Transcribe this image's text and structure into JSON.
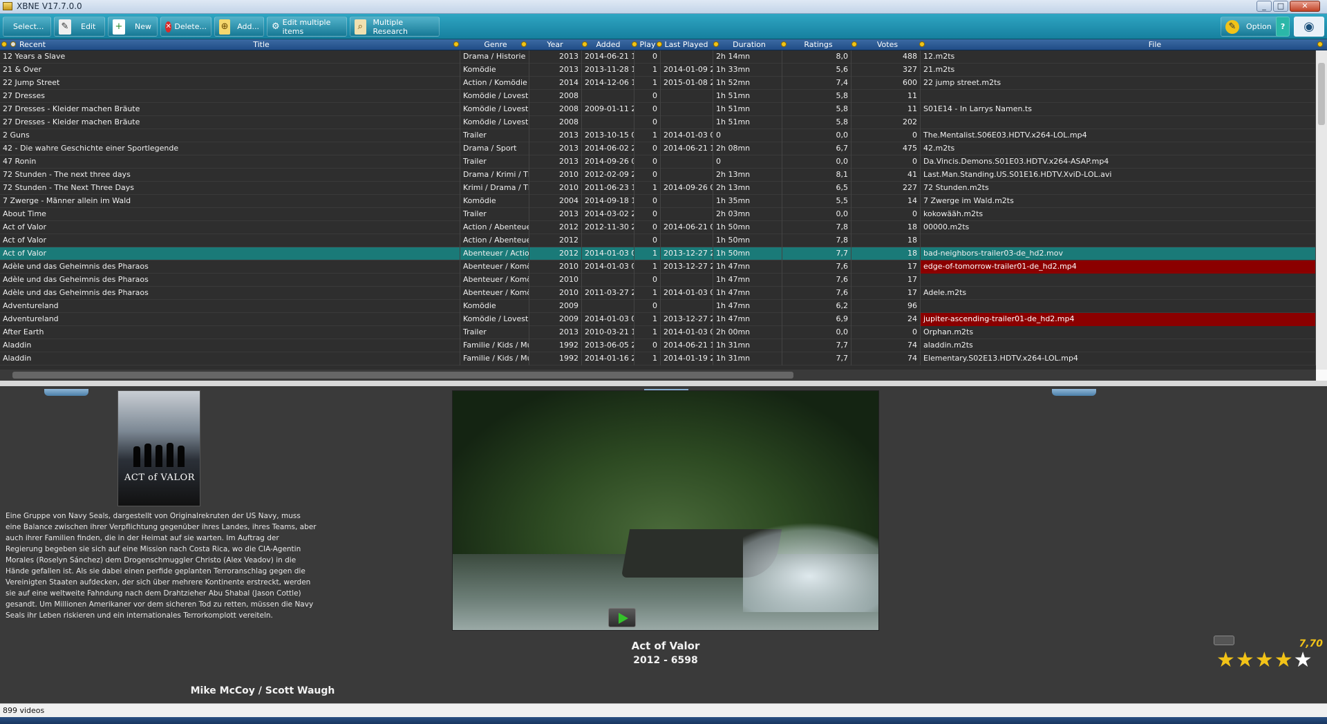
{
  "window": {
    "title": "XBNE V17.7.0.0",
    "min": "_",
    "max": "□",
    "close": "✕"
  },
  "toolbar": {
    "select": "Select...",
    "edit": "Edit",
    "new": "New",
    "delete": "Delete...",
    "add": "Add...",
    "edit_multiple": "Edit multiple items",
    "multiple_research": "Multiple Research",
    "option": "Option",
    "help": "?"
  },
  "columns": {
    "recent": "Recent",
    "title": "Title",
    "genre": "Genre",
    "year": "Year",
    "added": "Added",
    "play": "Play",
    "last_played": "Last Played",
    "duration": "Duration",
    "ratings": "Ratings",
    "votes": "Votes",
    "file": "File"
  },
  "rows": [
    {
      "title": "12 Years a Slave",
      "genre": "Drama / Historie",
      "year": "2013",
      "added": "2014-06-21 1",
      "play": "0",
      "last": "",
      "dur": "2h 14mn",
      "rating": "8,0",
      "votes": "488",
      "file": "12.m2ts"
    },
    {
      "title": "21 & Over",
      "genre": "Komödie",
      "year": "2013",
      "added": "2013-11-28 1",
      "play": "1",
      "last": "2014-01-09 22",
      "dur": "1h 33mn",
      "rating": "5,6",
      "votes": "327",
      "file": "21.m2ts"
    },
    {
      "title": "22 Jump Street",
      "genre": "Action / Komödie /",
      "year": "2014",
      "added": "2014-12-06 1",
      "play": "1",
      "last": "2015-01-08 23",
      "dur": "1h 52mn",
      "rating": "7,4",
      "votes": "600",
      "file": "22 jump street.m2ts"
    },
    {
      "title": "27 Dresses",
      "genre": "Komödie / Lovesto",
      "year": "2008",
      "added": "",
      "play": "0",
      "last": "",
      "dur": "1h 51mn",
      "rating": "5,8",
      "votes": "11",
      "file": ""
    },
    {
      "title": "27 Dresses - Kleider machen Bräute",
      "genre": "Komödie / Lovesto",
      "year": "2008",
      "added": "2009-01-11 2",
      "play": "0",
      "last": "",
      "dur": "1h 51mn",
      "rating": "5,8",
      "votes": "11",
      "file": "S01E14 - In Larrys Namen.ts"
    },
    {
      "title": "27 Dresses - Kleider machen Bräute",
      "genre": "Komödie / Lovesto",
      "year": "2008",
      "added": "",
      "play": "0",
      "last": "",
      "dur": "1h 51mn",
      "rating": "5,8",
      "votes": "202",
      "file": ""
    },
    {
      "title": "2 Guns",
      "genre": "Trailer",
      "year": "2013",
      "added": "2013-10-15 0",
      "play": "1",
      "last": "2014-01-03 02",
      "dur": "0",
      "rating": "0,0",
      "votes": "0",
      "file": "The.Mentalist.S06E03.HDTV.x264-LOL.mp4"
    },
    {
      "title": "42 - Die wahre Geschichte einer Sportlegende",
      "genre": "Drama / Sport",
      "year": "2013",
      "added": "2014-06-02 2",
      "play": "0",
      "last": "2014-06-21 14",
      "dur": "2h 08mn",
      "rating": "6,7",
      "votes": "475",
      "file": "42.m2ts"
    },
    {
      "title": "47 Ronin",
      "genre": "Trailer",
      "year": "2013",
      "added": "2014-09-26 0",
      "play": "0",
      "last": "",
      "dur": "0",
      "rating": "0,0",
      "votes": "0",
      "file": "Da.Vincis.Demons.S01E03.HDTV.x264-ASAP.mp4"
    },
    {
      "title": "72 Stunden - The next three days",
      "genre": "Drama / Krimi / Th",
      "year": "2010",
      "added": "2012-02-09 2",
      "play": "0",
      "last": "",
      "dur": "2h 13mn",
      "rating": "8,1",
      "votes": "41",
      "file": "Last.Man.Standing.US.S01E16.HDTV.XviD-LOL.avi"
    },
    {
      "title": "72 Stunden - The Next Three Days",
      "genre": "Krimi / Drama / Th",
      "year": "2010",
      "added": "2011-06-23 1",
      "play": "1",
      "last": "2014-09-26 00",
      "dur": "2h 13mn",
      "rating": "6,5",
      "votes": "227",
      "file": "72 Stunden.m2ts"
    },
    {
      "title": "7 Zwerge - Männer allein im Wald",
      "genre": "Komödie",
      "year": "2004",
      "added": "2014-09-18 1",
      "play": "0",
      "last": "",
      "dur": "1h 35mn",
      "rating": "5,5",
      "votes": "14",
      "file": "7 Zwerge im Wald.m2ts"
    },
    {
      "title": "About Time",
      "genre": "Trailer",
      "year": "2013",
      "added": "2014-03-02 2",
      "play": "0",
      "last": "",
      "dur": "2h 03mn",
      "rating": "0,0",
      "votes": "0",
      "file": "kokowääh.m2ts"
    },
    {
      "title": "Act of Valor",
      "genre": "Action / Abenteuer",
      "year": "2012",
      "added": "2012-11-30 2",
      "play": "0",
      "last": "2014-06-21 01",
      "dur": "1h 50mn",
      "rating": "7,8",
      "votes": "18",
      "file": "00000.m2ts"
    },
    {
      "title": "Act of Valor",
      "genre": "Action / Abenteuer",
      "year": "2012",
      "added": "",
      "play": "0",
      "last": "",
      "dur": "1h 50mn",
      "rating": "7,8",
      "votes": "18",
      "file": ""
    },
    {
      "title": "Act of Valor",
      "genre": "Abenteuer / Actior",
      "year": "2012",
      "added": "2014-01-03 0",
      "play": "1",
      "last": "2013-12-27 21",
      "dur": "1h 50mn",
      "rating": "7,7",
      "votes": "18",
      "file": "bad-neighbors-trailer03-de_hd2.mov",
      "selected": true
    },
    {
      "title": "Adèle und das Geheimnis des Pharaos",
      "genre": "Abenteuer / Komöc",
      "year": "2010",
      "added": "2014-01-03 0",
      "play": "1",
      "last": "2013-12-27 21",
      "dur": "1h 47mn",
      "rating": "7,6",
      "votes": "17",
      "file": "edge-of-tomorrow-trailer01-de_hd2.mp4",
      "highlight": true
    },
    {
      "title": "Adèle und das Geheimnis des Pharaos",
      "genre": "Abenteuer / Komöc",
      "year": "2010",
      "added": "",
      "play": "0",
      "last": "",
      "dur": "1h 47mn",
      "rating": "7,6",
      "votes": "17",
      "file": ""
    },
    {
      "title": "Adèle und das Geheimnis des Pharaos",
      "genre": "Abenteuer / Komöc",
      "year": "2010",
      "added": "2011-03-27 2",
      "play": "1",
      "last": "2014-01-03 03",
      "dur": "1h 47mn",
      "rating": "7,6",
      "votes": "17",
      "file": "Adele.m2ts"
    },
    {
      "title": "Adventureland",
      "genre": "Komödie",
      "year": "2009",
      "added": "",
      "play": "0",
      "last": "",
      "dur": "1h 47mn",
      "rating": "6,2",
      "votes": "96",
      "file": ""
    },
    {
      "title": "Adventureland",
      "genre": "Komödie / Lovesto",
      "year": "2009",
      "added": "2014-01-03 0",
      "play": "1",
      "last": "2013-12-27 21",
      "dur": "1h 47mn",
      "rating": "6,9",
      "votes": "24",
      "file": "jupiter-ascending-trailer01-de_hd2.mp4",
      "highlight": true
    },
    {
      "title": "After Earth",
      "genre": "Trailer",
      "year": "2013",
      "added": "2010-03-21 1",
      "play": "1",
      "last": "2014-01-03 03",
      "dur": "2h 00mn",
      "rating": "0,0",
      "votes": "0",
      "file": "Orphan.m2ts"
    },
    {
      "title": "Aladdin",
      "genre": "Familie / Kids / Mu:",
      "year": "1992",
      "added": "2013-06-05 2",
      "play": "0",
      "last": "2014-06-21 14",
      "dur": "1h 31mn",
      "rating": "7,7",
      "votes": "74",
      "file": "aladdin.m2ts"
    },
    {
      "title": "Aladdin",
      "genre": "Familie / Kids / Mu:",
      "year": "1992",
      "added": "2014-01-16 2",
      "play": "1",
      "last": "2014-01-19 21",
      "dur": "1h 31mn",
      "rating": "7,7",
      "votes": "74",
      "file": "Elementary.S02E13.HDTV.x264-LOL.mp4"
    }
  ],
  "detail": {
    "poster_title": "ACT of VALOR",
    "description": "Eine Gruppe von Navy Seals, dargestellt von Originalrekruten der US Navy, muss eine Balance zwischen ihrer Verpflichtung gegenüber ihres Landes, ihres Teams, aber auch ihrer Familien finden, die in der Heimat auf sie warten. Im Auftrag der Regierung begeben sie sich auf eine Mission nach Costa Rica, wo die CIA-Agentin Morales (Roselyn Sánchez) dem Drogenschmuggler Christo (Alex Veadov) in die Hände gefallen ist. Als sie dabei einen perfide geplanten Terroranschlag gegen die Vereinigten Staaten aufdecken, der sich über mehrere Kontinente erstreckt, werden sie auf eine weltweite Fahndung nach dem Drahtzieher Abu Shabal (Jason Cottle) gesandt. Um Millionen Amerikaner vor dem sicheren Tod zu retten, müssen die Navy Seals ihr Leben riskieren und ein internationales Terrorkomplott vereiteln.",
    "movie_title": "Act of Valor",
    "movie_sub": "2012 - 6598",
    "directors": "Mike McCoy / Scott Waugh",
    "rating": "7,70",
    "stars_filled": 4,
    "stars_total": 5
  },
  "status": {
    "count": "899 videos"
  },
  "colors": {
    "toolbar": "#1f93b2",
    "header": "#2d5a93",
    "selected_row": "#1a7a78",
    "highlight_file": "#8b0000",
    "star": "#f2c318"
  }
}
